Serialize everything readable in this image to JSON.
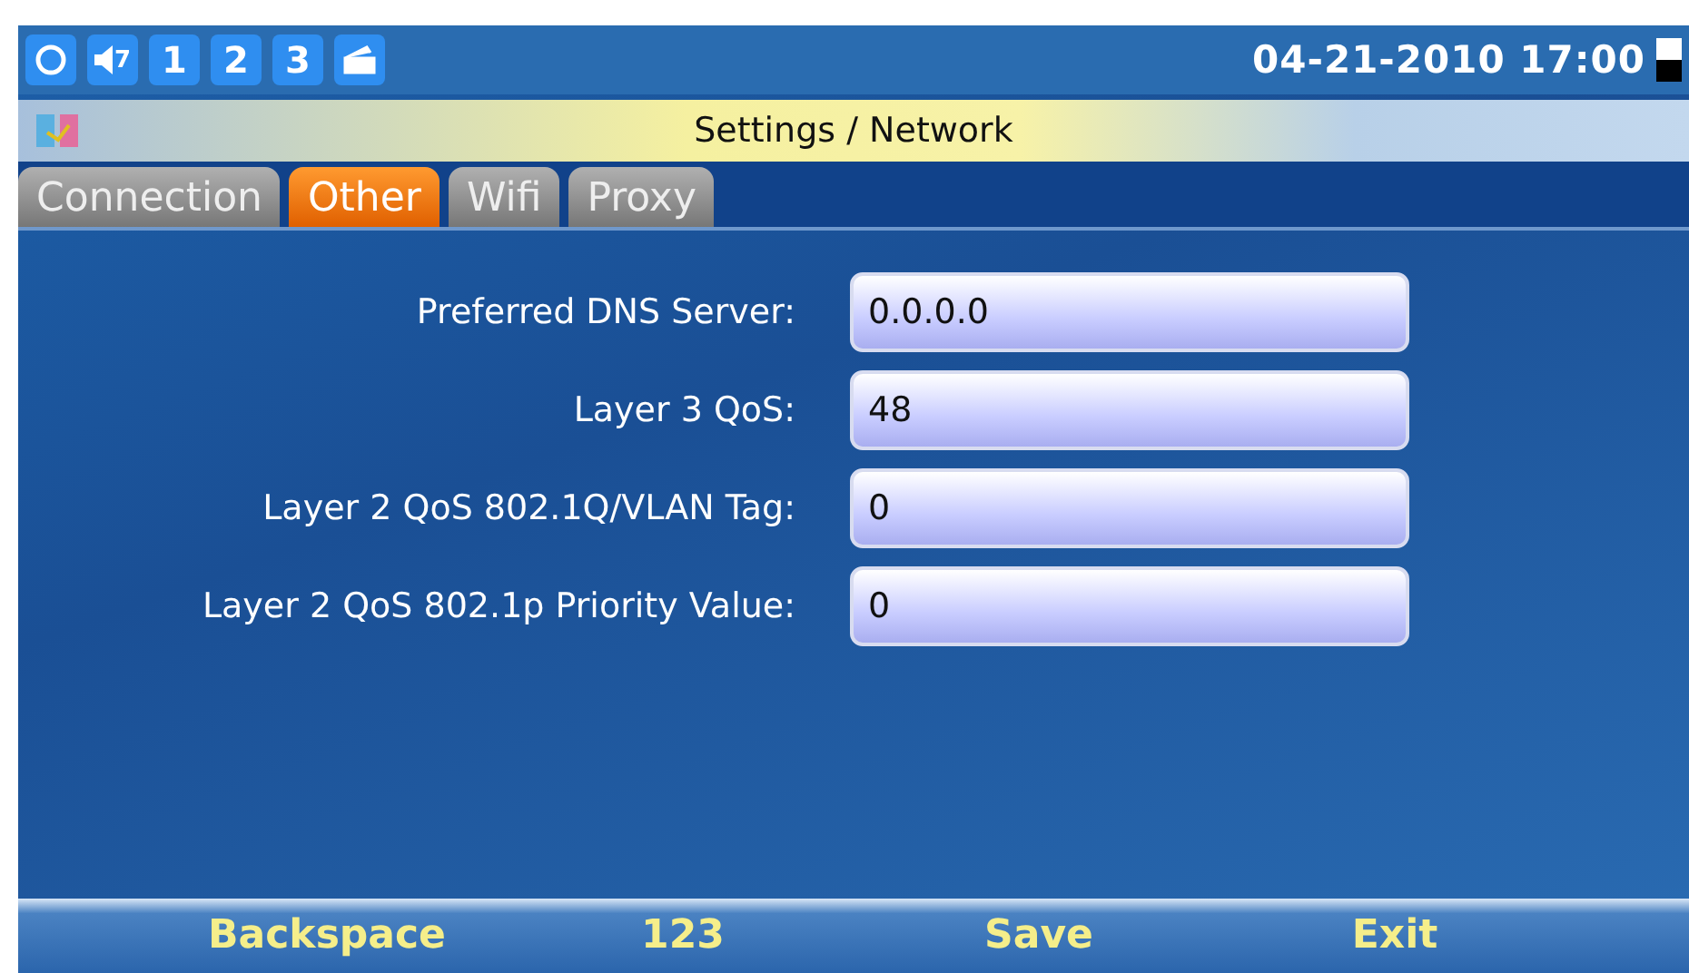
{
  "status_bar": {
    "icons": [
      {
        "kind": "network"
      },
      {
        "kind": "volume",
        "label": "7"
      },
      {
        "kind": "line",
        "label": "1"
      },
      {
        "kind": "line",
        "label": "2"
      },
      {
        "kind": "line",
        "label": "3"
      },
      {
        "kind": "message"
      }
    ],
    "datetime": "04-21-2010 17:00"
  },
  "window": {
    "title": "Settings / Network"
  },
  "tabs": [
    {
      "label": "Connection",
      "selected": false
    },
    {
      "label": "Other",
      "selected": true
    },
    {
      "label": "Wifi",
      "selected": false
    },
    {
      "label": "Proxy",
      "selected": false
    }
  ],
  "fields": [
    {
      "label": "Preferred DNS Server:",
      "value": "0.0.0.0"
    },
    {
      "label": "Layer 3 QoS:",
      "value": "48"
    },
    {
      "label": "Layer 2 QoS 802.1Q/VLAN Tag:",
      "value": "0"
    },
    {
      "label": "Layer 2 QoS 802.1p Priority Value:",
      "value": "0"
    }
  ],
  "softkeys": [
    "Backspace",
    "123",
    "Save",
    "Exit"
  ]
}
